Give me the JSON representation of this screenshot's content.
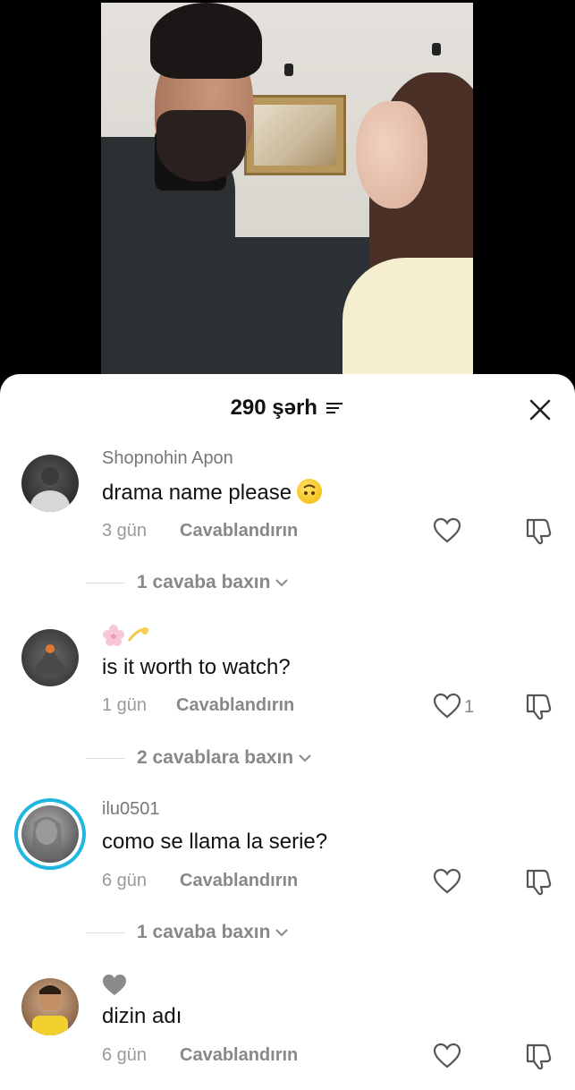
{
  "header": {
    "count_label": "290 şərh"
  },
  "comments": [
    {
      "username": "Shopnohin Apon",
      "text": "drama name please",
      "time": "3 gün",
      "reply_label": "Cavablandırın",
      "likes": "",
      "replies_label": "1 cavaba baxın"
    },
    {
      "username": "🌸💫",
      "text": "is it worth to watch?",
      "time": "1 gün",
      "reply_label": "Cavablandırın",
      "likes": "1",
      "replies_label": "2 cavablara baxın"
    },
    {
      "username": "ilu0501",
      "text": "como se llama la serie?",
      "time": "6 gün",
      "reply_label": "Cavablandırın",
      "likes": "",
      "replies_label": "1 cavaba baxın"
    },
    {
      "username": "🩶",
      "text": "dizin adı",
      "time": "6 gün",
      "reply_label": "Cavablandırın",
      "likes": ""
    }
  ],
  "colors": {
    "story_ring": "#1fb6e0",
    "accent_text": "#111111",
    "muted": "#888888"
  }
}
